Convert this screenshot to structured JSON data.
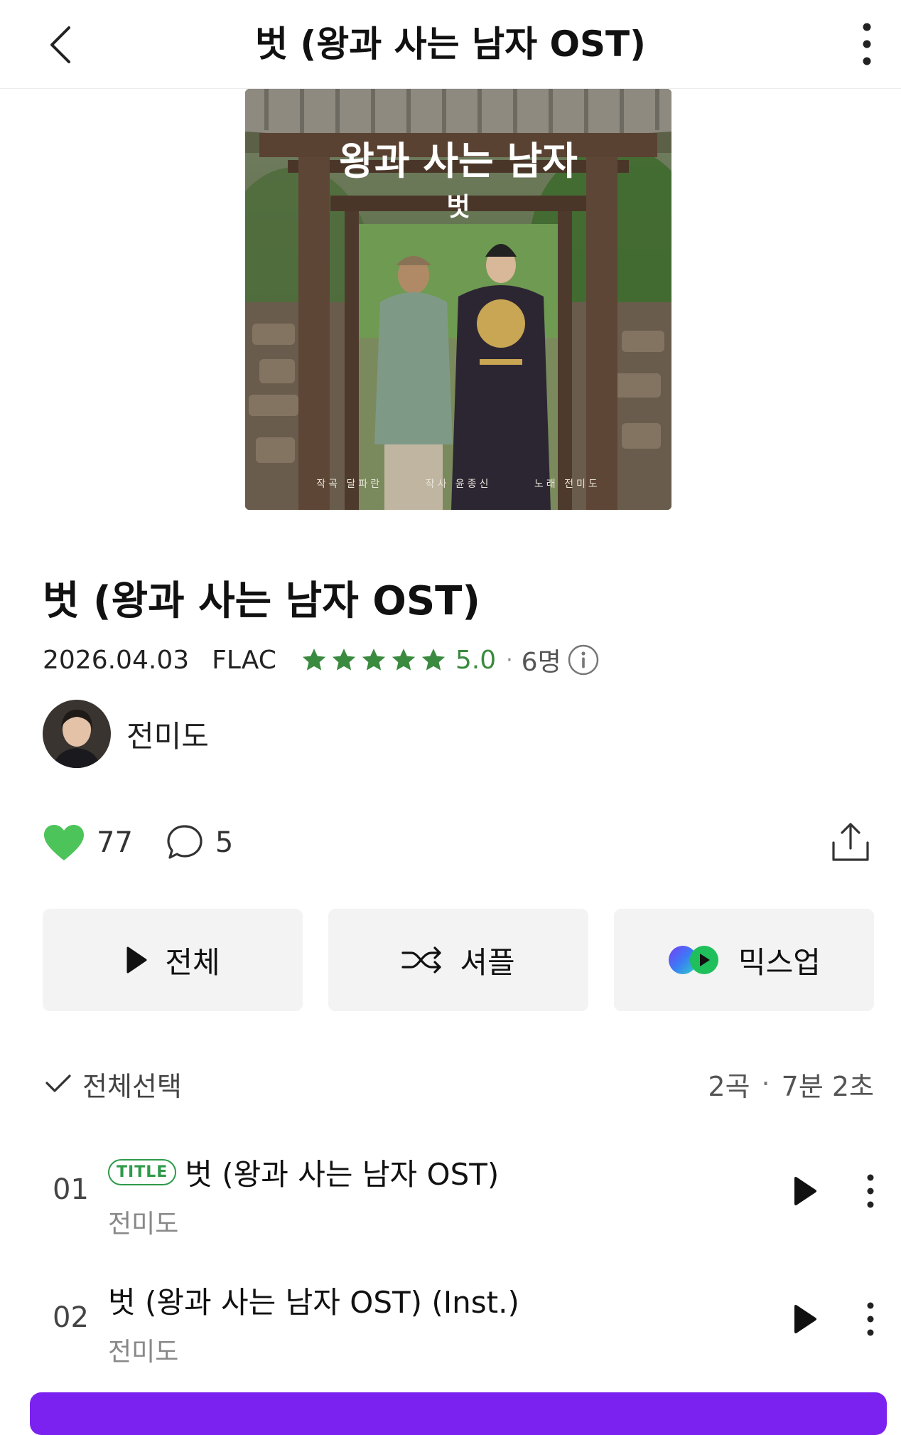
{
  "header": {
    "title": "벗 (왕과 사는 남자 OST)",
    "back_icon": "chevron-left-icon",
    "more_icon": "more-vertical-icon"
  },
  "album": {
    "art_title": "왕과 사는 남자",
    "art_subtitle": "벗",
    "art_credits": [
      "작곡 달파란",
      "작사 윤종신",
      "노래 전미도"
    ],
    "title": "벗 (왕과 사는 남자 OST)",
    "release_date": "2026.04.03",
    "format": "FLAC",
    "stars": 5,
    "rating": "5.0",
    "rating_separator": "·",
    "rater_count": "6명",
    "artist": "전미도"
  },
  "social": {
    "likes": "77",
    "comments": "5",
    "like_color": "#4cc45a"
  },
  "actions": {
    "play_all": "전체",
    "shuffle": "셔플",
    "mixup": "믹스업"
  },
  "list_header": {
    "select_all": "전체선택",
    "track_count": "2곡",
    "separator": "·",
    "duration": "7분 2초"
  },
  "tracks": [
    {
      "number": "01",
      "badge": "TITLE",
      "title": "벗 (왕과 사는 남자 OST)",
      "artist": "전미도"
    },
    {
      "number": "02",
      "badge": "",
      "title": "벗 (왕과 사는 남자 OST) (Inst.)",
      "artist": "전미도"
    }
  ],
  "colors": {
    "accent_green": "#3a8a3f",
    "badge_green": "#2e9a4a",
    "bottom_bar": "#7b22f0"
  }
}
